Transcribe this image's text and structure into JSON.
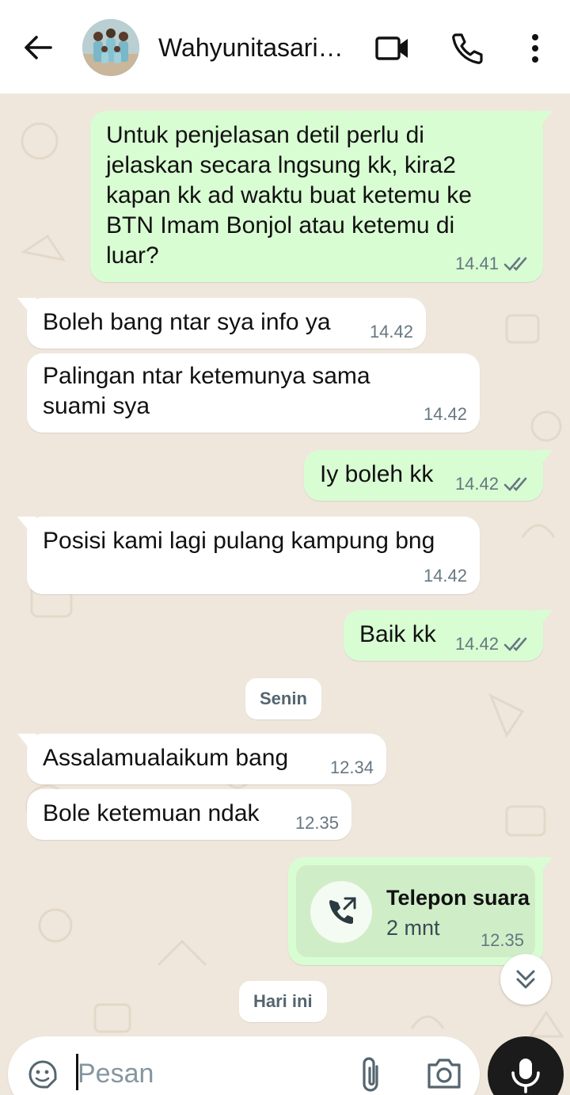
{
  "header": {
    "contact_name": "Wahyunitasari…",
    "icons": [
      "back-arrow-icon",
      "video-call-icon",
      "voice-call-icon",
      "more-vert-icon"
    ]
  },
  "messages": [
    {
      "dir": "out",
      "lines": [
        "Untuk penjelasan detil perlu di",
        "jelaskan secara lngsung kk, kira2",
        "kapan kk ad waktu buat ketemu ke",
        "BTN Imam Bonjol atau ketemu di",
        "luar?"
      ],
      "time": "14.41"
    },
    {
      "dir": "in",
      "lines": [
        "Boleh bang ntar sya info ya"
      ],
      "time": "14.42"
    },
    {
      "dir": "in",
      "lines": [
        "Palingan ntar ketemunya sama",
        "suami sya"
      ],
      "time": "14.42"
    },
    {
      "dir": "out",
      "lines": [
        "Iy boleh kk"
      ],
      "time": "14.42"
    },
    {
      "dir": "in",
      "lines": [
        "Posisi kami lagi pulang kampung bng"
      ],
      "time": "14.42"
    },
    {
      "dir": "out",
      "lines": [
        "Baik kk"
      ],
      "time": "14.42"
    },
    {
      "dir": "in",
      "lines": [
        "Assalamualaikum bang"
      ],
      "time": "12.34"
    },
    {
      "dir": "in",
      "lines": [
        "Bole ketemuan ndak"
      ],
      "time": "12.35"
    }
  ],
  "date_chips": {
    "monday": "Senin",
    "today": "Hari ini"
  },
  "call": {
    "title": "Telepon suara",
    "duration": "2 mnt",
    "time": "12.35"
  },
  "composer": {
    "placeholder": "Pesan"
  },
  "colors": {
    "incoming": "#ffffff",
    "outgoing": "#d9fdd3",
    "wallpaper": "#efe7dc",
    "mic_button": "#1b1b1b"
  }
}
